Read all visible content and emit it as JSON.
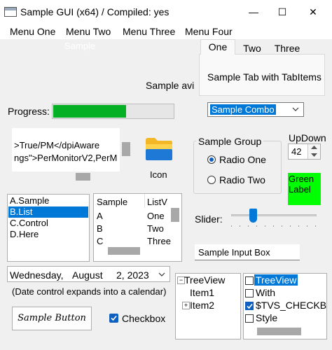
{
  "window": {
    "title": "Sample GUI (x64) / Compiled: yes",
    "minimize_icon": "—",
    "maximize_icon": "☐",
    "close_icon": "✕"
  },
  "menu": [
    {
      "label": "Menu One"
    },
    {
      "label": "Menu Two"
    },
    {
      "label": "Menu Three"
    },
    {
      "label": "Menu Four"
    }
  ],
  "ghost_text": "Sample",
  "tabs": {
    "items": [
      {
        "label": "One"
      },
      {
        "label": "Two"
      },
      {
        "label": "Three"
      }
    ],
    "selected": "One",
    "content": "Sample Tab with TabItems"
  },
  "avi_label": "Sample avi",
  "progress": {
    "label": "Progress:",
    "value_percent": 60
  },
  "combo": {
    "value": "Sample Combo"
  },
  "edit": {
    "lines": [
      ">True/PM</dpiAware",
      "ngs\">PerMonitorV2,PerM"
    ]
  },
  "icon_control": {
    "label": "Icon"
  },
  "group": {
    "label": "Sample Group",
    "radios": [
      {
        "label": "Radio One",
        "selected": true
      },
      {
        "label": "Radio Two",
        "selected": false
      }
    ]
  },
  "updown": {
    "label": "UpDown",
    "value": "42"
  },
  "green_label": {
    "text": "Green Label",
    "color": "#00ff00"
  },
  "listbox": {
    "items": [
      "A.Sample",
      "B.List",
      "C.Control",
      "D.Here"
    ],
    "selected_index": 1
  },
  "listview": {
    "columns": [
      "Sample",
      "ListV"
    ],
    "rows": [
      {
        "col1": "A",
        "col2": "One"
      },
      {
        "col1": "B",
        "col2": "Two"
      },
      {
        "col1": "C",
        "col2": "Three"
      }
    ]
  },
  "slider": {
    "label": "Slider:",
    "value_fraction": 0.25
  },
  "input": {
    "value": "Sample Input Box"
  },
  "date": {
    "weekday": "Wednesday,",
    "month": "August",
    "day_year": "2, 2023",
    "hint": "(Date control expands into a calendar)"
  },
  "treeview": {
    "items": [
      {
        "label": "TreeView",
        "expander": "−"
      },
      {
        "label": "Item1",
        "expander": ""
      },
      {
        "label": "Item2",
        "expander": "+"
      }
    ]
  },
  "checklist": {
    "items": [
      {
        "label": "TreeView",
        "checked": false,
        "selected": true
      },
      {
        "label": "With",
        "checked": false,
        "selected": false
      },
      {
        "label": "$TVS_CHECKBOXES",
        "checked": true,
        "selected": false
      },
      {
        "label": "Style",
        "checked": false,
        "selected": false
      }
    ]
  },
  "button": {
    "label": "Sample Button"
  },
  "checkbox": {
    "label": "Checkbox",
    "checked": true
  },
  "colors": {
    "accent": "#0078d7",
    "progress": "#06b025",
    "green_label": "#00ff00"
  }
}
